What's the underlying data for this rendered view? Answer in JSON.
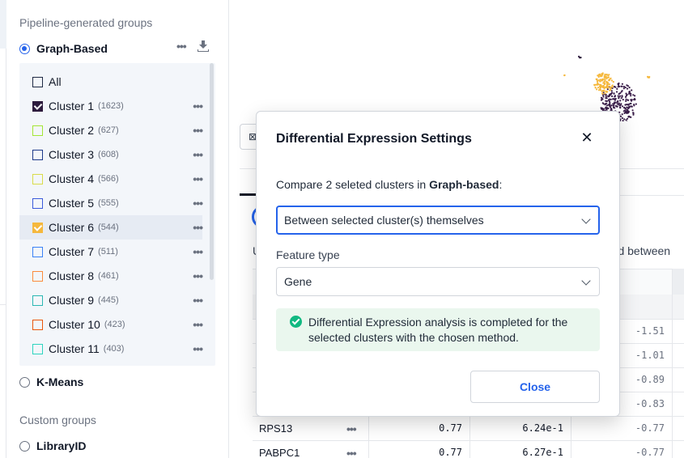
{
  "sidebar": {
    "pipeline_title": "Pipeline-generated groups",
    "graph_based_label": "Graph-Based",
    "kmeans_label": "K-Means",
    "custom_title": "Custom groups",
    "library_label": "LibraryID",
    "more_label": "•••",
    "clusters": [
      {
        "label": "All",
        "count": "",
        "color": "#1f2a44",
        "checked": false
      },
      {
        "label": "Cluster 1",
        "count": "(1623)",
        "color": "#2d1b3d",
        "checked": true
      },
      {
        "label": "Cluster 2",
        "count": "(627)",
        "color": "#a3e635",
        "checked": false
      },
      {
        "label": "Cluster 3",
        "count": "(608)",
        "color": "#1e3a8a",
        "checked": false
      },
      {
        "label": "Cluster 4",
        "count": "(566)",
        "color": "#d9dc4a",
        "checked": false
      },
      {
        "label": "Cluster 5",
        "count": "(555)",
        "color": "#3b5bdb",
        "checked": false
      },
      {
        "label": "Cluster 6",
        "count": "(544)",
        "color": "#f5b83d",
        "checked": true
      },
      {
        "label": "Cluster 7",
        "count": "(511)",
        "color": "#3b82f6",
        "checked": false
      },
      {
        "label": "Cluster 8",
        "count": "(461)",
        "color": "#fb8c3c",
        "checked": false
      },
      {
        "label": "Cluster 9",
        "count": "(445)",
        "color": "#2bb7b3",
        "checked": false
      },
      {
        "label": "Cluster 10",
        "count": "(423)",
        "color": "#ea580c",
        "checked": false
      },
      {
        "label": "Cluster 11",
        "count": "(403)",
        "color": "#2dd4bf",
        "checked": false
      }
    ]
  },
  "background": {
    "tab_partial": "n",
    "text_partial": "red between",
    "u_partial": "U",
    "table_rows": [
      {
        "gene": "",
        "a": "",
        "b": "",
        "c": "-1.51"
      },
      {
        "gene": "",
        "a": "",
        "b": "",
        "c": "-1.01"
      },
      {
        "gene": "",
        "a": "",
        "b": "",
        "c": "-0.89"
      },
      {
        "gene": "",
        "a": "",
        "b": "",
        "c": "-0.83"
      },
      {
        "gene": "RPS13",
        "a": "0.77",
        "b": "6.24e-1",
        "c": "-0.77"
      },
      {
        "gene": "PABPC1",
        "a": "0.77",
        "b": "6.27e-1",
        "c": "-0.77"
      }
    ]
  },
  "modal": {
    "title": "Differential Expression Settings",
    "close_glyph": "✕",
    "compare_prefix": "Compare 2 seleted clusters in ",
    "compare_group": "Graph-based",
    "compare_suffix": ":",
    "mode_value": "Between selected cluster(s) themselves",
    "feature_label": "Feature type",
    "feature_value": "Gene",
    "success_message": "Differential Expression analysis is completed for the selected clusters with the chosen method.",
    "close_button": "Close"
  },
  "colors": {
    "accent": "#2563eb",
    "success": "#10b981",
    "umap_purple": "#3b1f4a",
    "umap_yellow": "#f5b83d"
  }
}
